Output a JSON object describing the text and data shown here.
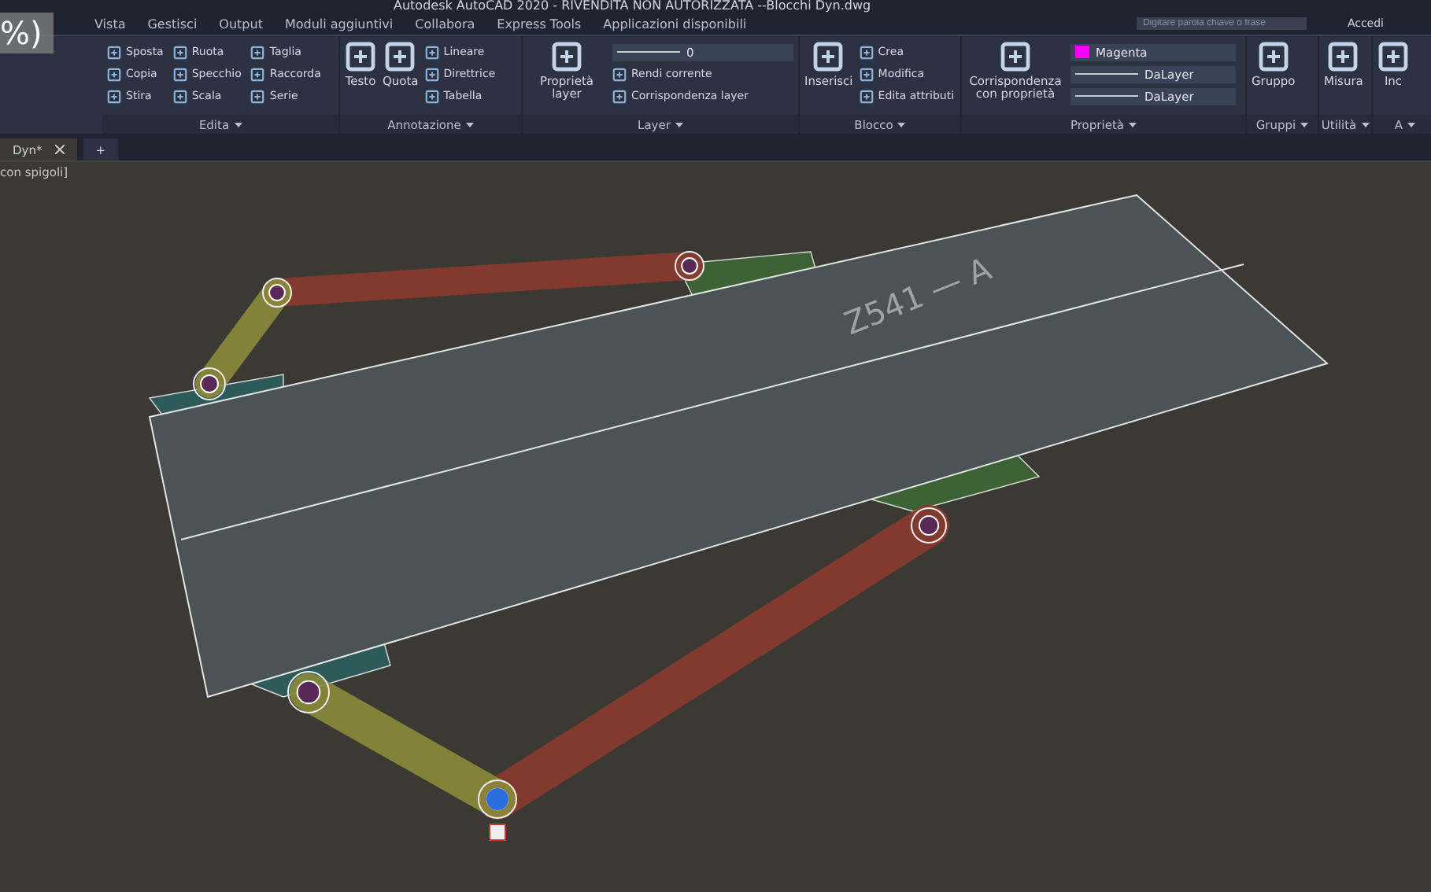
{
  "window": {
    "title": "Autodesk AutoCAD 2020 - RIVENDITA NON AUTORIZZATA    --Blocchi Dyn.dwg",
    "search": {
      "placeholder": "Digitare parola chiave o frase"
    },
    "account": "Accedi"
  },
  "overlay_text": "%)",
  "menu": [
    "Vista",
    "Gestisci",
    "Output",
    "Moduli aggiuntivi",
    "Collabora",
    "Express Tools",
    "Applicazioni disponibili"
  ],
  "ribbon": {
    "panels": [
      {
        "title": "Edita",
        "tools": [
          {
            "kind": "small",
            "label": "Sposta"
          },
          {
            "kind": "small",
            "label": "Copia"
          },
          {
            "kind": "small",
            "label": "Stira"
          },
          {
            "kind": "small",
            "label": "Ruota"
          },
          {
            "kind": "small",
            "label": "Specchio"
          },
          {
            "kind": "small",
            "label": "Scala"
          },
          {
            "kind": "small",
            "label": "Taglia"
          },
          {
            "kind": "small",
            "label": "Raccorda"
          },
          {
            "kind": "small",
            "label": "Serie"
          }
        ]
      },
      {
        "title": "Annotazione",
        "tools": [
          {
            "kind": "large",
            "label": "Testo"
          },
          {
            "kind": "large",
            "label": "Quota"
          },
          {
            "kind": "small",
            "label": "Lineare"
          },
          {
            "kind": "small",
            "label": "Direttrice"
          },
          {
            "kind": "small",
            "label": "Tabella"
          }
        ]
      },
      {
        "title": "Layer",
        "tools": [
          {
            "kind": "large",
            "label": "Proprietà layer"
          },
          {
            "kind": "combo",
            "label": "0"
          },
          {
            "kind": "small",
            "label": "Rendi corrente"
          },
          {
            "kind": "small",
            "label": "Corrispondenza layer"
          }
        ]
      },
      {
        "title": "Blocco",
        "tools": [
          {
            "kind": "large",
            "label": "Inserisci"
          },
          {
            "kind": "small",
            "label": "Crea"
          },
          {
            "kind": "small",
            "label": "Modifica"
          },
          {
            "kind": "small",
            "label": "Edita attributi"
          }
        ]
      },
      {
        "title": "Proprietà",
        "tools": [
          {
            "kind": "large",
            "label": "Corrispondenza con proprietà"
          },
          {
            "kind": "combo",
            "label": "Magenta",
            "color": "#ff00ff"
          },
          {
            "kind": "combo",
            "label": "DaLayer"
          },
          {
            "kind": "combo",
            "label": "DaLayer"
          }
        ]
      },
      {
        "title": "Gruppi",
        "tools": [
          {
            "kind": "large",
            "label": "Gruppo"
          }
        ]
      },
      {
        "title": "Utilità",
        "tools": [
          {
            "kind": "large",
            "label": "Misura"
          }
        ]
      },
      {
        "title": "A",
        "tools": [
          {
            "kind": "large",
            "label": "Inc"
          }
        ]
      }
    ]
  },
  "file_tabs": [
    {
      "label": "Dyn*",
      "selected": true
    },
    {
      "label": "+",
      "selected": false
    }
  ],
  "viewport": {
    "label": "con spigoli]",
    "part_label": "Z541 — A"
  }
}
